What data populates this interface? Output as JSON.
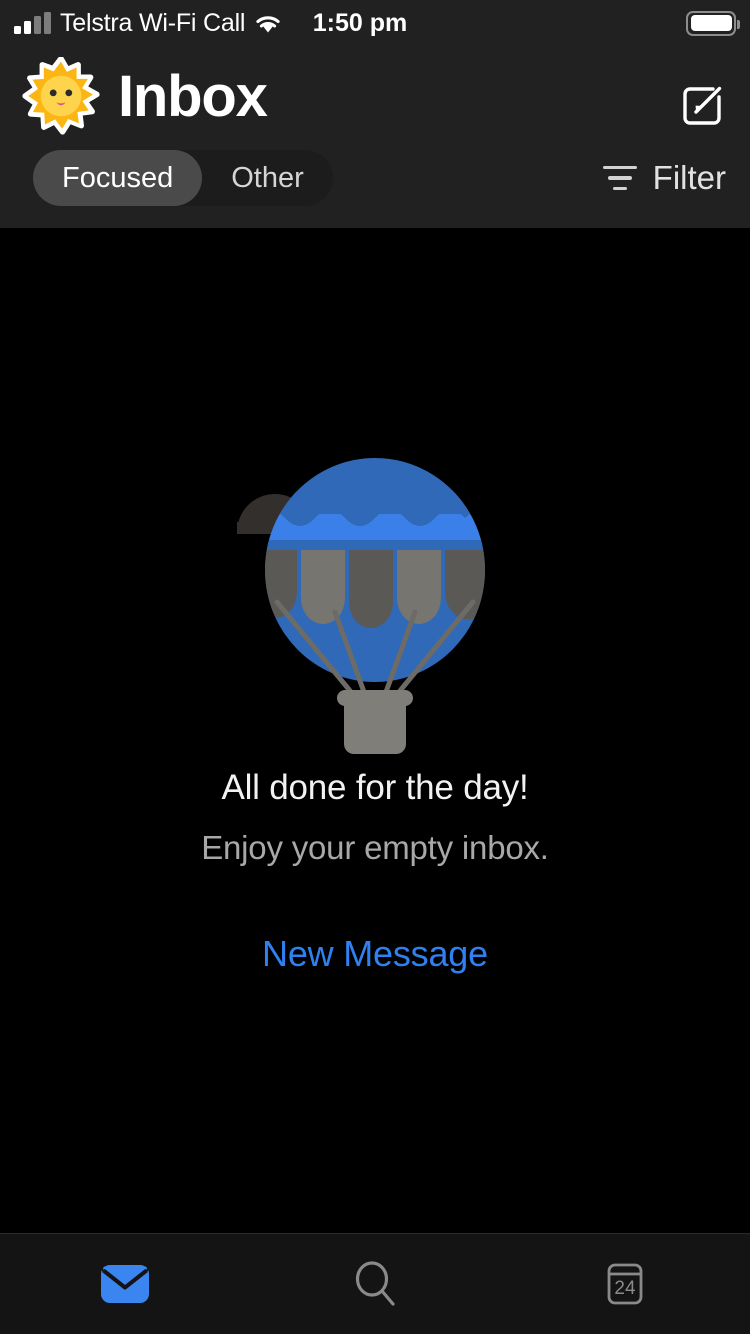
{
  "status_bar": {
    "carrier": "Telstra Wi-Fi Call",
    "time": "1:50 pm",
    "signal_icon": "cellular-signal-icon",
    "wifi_icon": "wifi-icon",
    "battery_icon": "battery-full-icon",
    "signal_bars_filled": 2,
    "signal_bars_total": 4,
    "battery_level_percent": 100
  },
  "header": {
    "account_icon": "sun-emoji-icon",
    "title": "Inbox",
    "compose_icon": "compose-pencil-icon",
    "segmented": {
      "options": [
        "Focused",
        "Other"
      ],
      "selected": "Focused"
    },
    "filter": {
      "label": "Filter",
      "icon": "filter-lines-icon"
    }
  },
  "empty_state": {
    "illustration": "hot-air-balloon-illustration",
    "title": "All done for the day!",
    "subtitle": "Enjoy your empty inbox.",
    "action_label": "New Message"
  },
  "tab_bar": {
    "tabs": [
      {
        "name": "mail",
        "icon": "mail-envelope-icon",
        "active": true
      },
      {
        "name": "search",
        "icon": "search-magnifier-icon",
        "active": false
      },
      {
        "name": "calendar",
        "icon": "calendar-icon",
        "active": false
      }
    ],
    "calendar_day": "24"
  },
  "colors": {
    "accent_blue": "#2f80f0",
    "balloon_blue": "#3069b8",
    "balloon_light_blue": "#3b7fe8",
    "header_bg": "#212121",
    "content_bg": "#000000",
    "tabbar_bg": "#141414",
    "panel_dark_gray": "#5b5955",
    "panel_light_gray": "#767570",
    "basket_gray": "#807e79",
    "inactive_icon": "#8a8a8a"
  }
}
